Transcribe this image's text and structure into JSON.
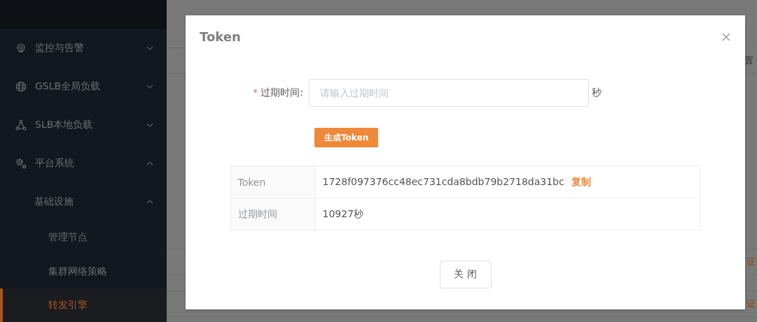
{
  "sidebar": {
    "items": [
      {
        "label": "监控与告警",
        "expanded": false
      },
      {
        "label": "GSLB全局负载",
        "expanded": false
      },
      {
        "label": "SLB本地负载",
        "expanded": false
      },
      {
        "label": "平台系统",
        "expanded": true,
        "children": [
          {
            "label": "基础设施",
            "expanded": true,
            "children": [
              {
                "label": "管理节点",
                "selected": false
              },
              {
                "label": "集群网络策略",
                "selected": false
              },
              {
                "label": "转发引擎",
                "selected": true
              }
            ]
          }
        ]
      }
    ]
  },
  "background_table": {
    "edge_texts": [
      {
        "text": "置",
        "kind": "header"
      },
      {
        "text": "证",
        "kind": "link"
      },
      {
        "text": "证",
        "kind": "link"
      }
    ]
  },
  "dialog": {
    "title": "Token",
    "form": {
      "label": "过期时间:",
      "required_mark": "*",
      "placeholder": "请输入过期时间",
      "unit": "秒"
    },
    "generate_button": "生成Token",
    "result": [
      {
        "label": "Token",
        "value": "1728f097376cc48ec731cda8bdb79b2718da31bc",
        "action": "复制"
      },
      {
        "label": "过期时间",
        "value": "10927秒"
      }
    ],
    "close_button": "关 闭"
  }
}
